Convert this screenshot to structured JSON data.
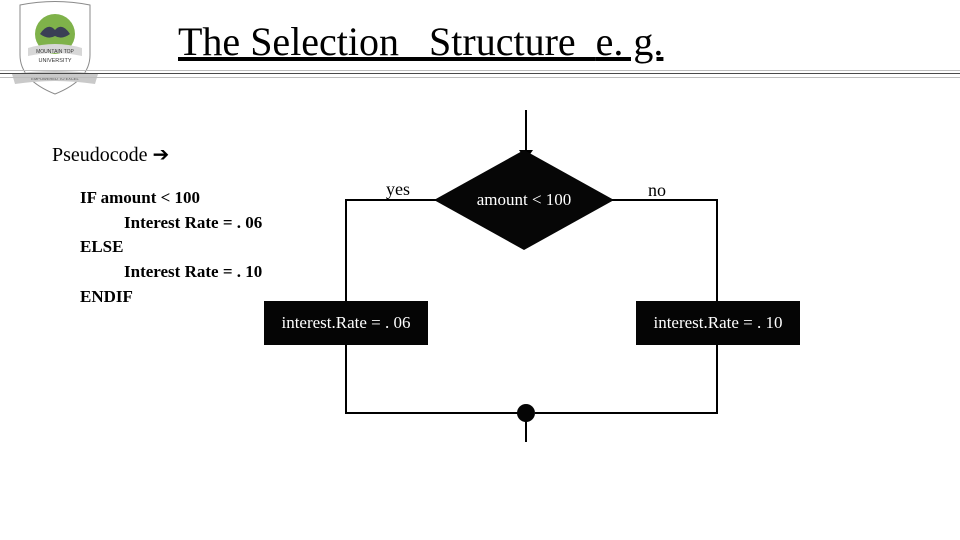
{
  "title_underlined": "The Selection   Structure  ",
  "title_plain": "e. g.",
  "pseudo_label": "Pseudocode ",
  "pseudo_arrow": "➔",
  "code": {
    "l1": "IF amount < 100",
    "l2": "Interest Rate = . 06",
    "l3": "ELSE",
    "l4": "Interest Rate = . 10",
    "l5": "ENDIF"
  },
  "diagram": {
    "decision": "amount < 100",
    "yes": "yes",
    "no": "no",
    "left_proc": "interest.Rate = . 06",
    "right_proc": "interest.Rate = . 10"
  },
  "logo": {
    "top_text": "MOUNTAIN TOP",
    "bottom_text": "UNIVERSITY",
    "ribbon": "EMPOWERED TO EXCEL"
  },
  "chart_data": {
    "type": "flowchart",
    "nodes": [
      {
        "id": "start",
        "kind": "entry"
      },
      {
        "id": "d1",
        "kind": "decision",
        "text": "amount < 100"
      },
      {
        "id": "p1",
        "kind": "process",
        "text": "interest.Rate = . 06"
      },
      {
        "id": "p2",
        "kind": "process",
        "text": "interest.Rate = . 10"
      },
      {
        "id": "join",
        "kind": "connector"
      }
    ],
    "edges": [
      {
        "from": "start",
        "to": "d1"
      },
      {
        "from": "d1",
        "to": "p1",
        "label": "yes"
      },
      {
        "from": "d1",
        "to": "p2",
        "label": "no"
      },
      {
        "from": "p1",
        "to": "join"
      },
      {
        "from": "p2",
        "to": "join"
      }
    ]
  }
}
